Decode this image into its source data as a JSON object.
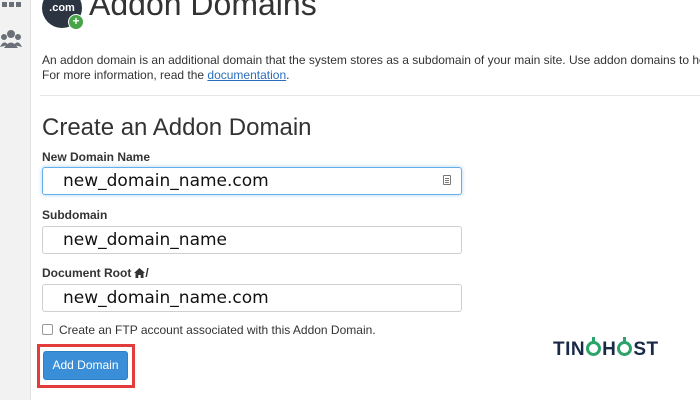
{
  "header": {
    "logo_text": ".com",
    "logo_badge": "+",
    "title": "Addon Domains"
  },
  "description": {
    "line1": "An addon domain is an additional domain that the system stores as a subdomain of your main site. Use addon domains to ho",
    "line2_prefix": "For more information, read the ",
    "link": "documentation",
    "line2_suffix": "."
  },
  "form": {
    "section_title": "Create an Addon Domain",
    "new_domain_label": "New Domain Name",
    "new_domain_value": "new_domain_name.com",
    "subdomain_label": "Subdomain",
    "subdomain_value": "new_domain_name",
    "docroot_label": "Document Root",
    "docroot_suffix": "/",
    "docroot_value": "new_domain_name.com",
    "ftp_label": "Create an FTP account associated with this Addon Domain.",
    "ftp_checked": false,
    "submit_label": "Add Domain"
  },
  "watermark": {
    "part1": "TIN",
    "part2": "H",
    "part3": "ST"
  },
  "colors": {
    "button": "#3a8ed8",
    "highlight": "#e23c3c",
    "link": "#2a6ebb",
    "focus": "#66afe9",
    "watermark_green": "#2ca36b"
  },
  "icons": [
    "grid-icon",
    "users-icon",
    "com-domain-icon",
    "autofill-icon",
    "home-icon",
    "checkbox"
  ]
}
